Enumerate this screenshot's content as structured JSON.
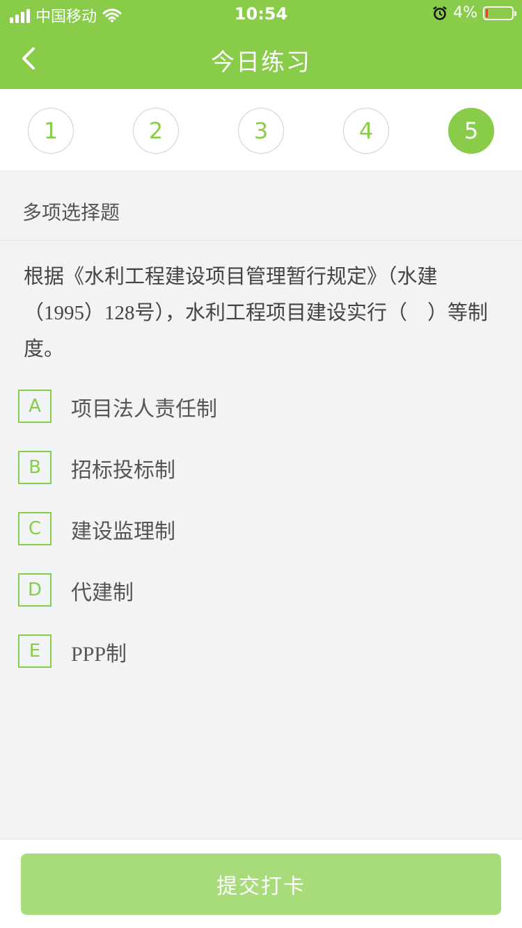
{
  "status_bar": {
    "carrier": "中国移动",
    "time": "10:54",
    "battery": "4%"
  },
  "nav": {
    "title": "今日练习",
    "back_icon": "chevron-left-icon"
  },
  "steps": [
    {
      "label": "1",
      "active": false
    },
    {
      "label": "2",
      "active": false
    },
    {
      "label": "3",
      "active": false
    },
    {
      "label": "4",
      "active": false
    },
    {
      "label": "5",
      "active": true
    }
  ],
  "question": {
    "type": "多项选择题",
    "text": "根据《水利工程建设项目管理暂行规定》（水建（1995）128号），水利工程项目建设实行（　）等制度。",
    "options": [
      {
        "key": "A",
        "text": "项目法人责任制"
      },
      {
        "key": "B",
        "text": "招标投标制"
      },
      {
        "key": "C",
        "text": "建设监理制"
      },
      {
        "key": "D",
        "text": "代建制"
      },
      {
        "key": "E",
        "text": "PPP制"
      }
    ]
  },
  "footer": {
    "submit_label": "提交打卡"
  },
  "colors": {
    "accent": "#88cc4a",
    "submit_disabled": "#a8dc7a",
    "background": "#f2f3f5"
  }
}
